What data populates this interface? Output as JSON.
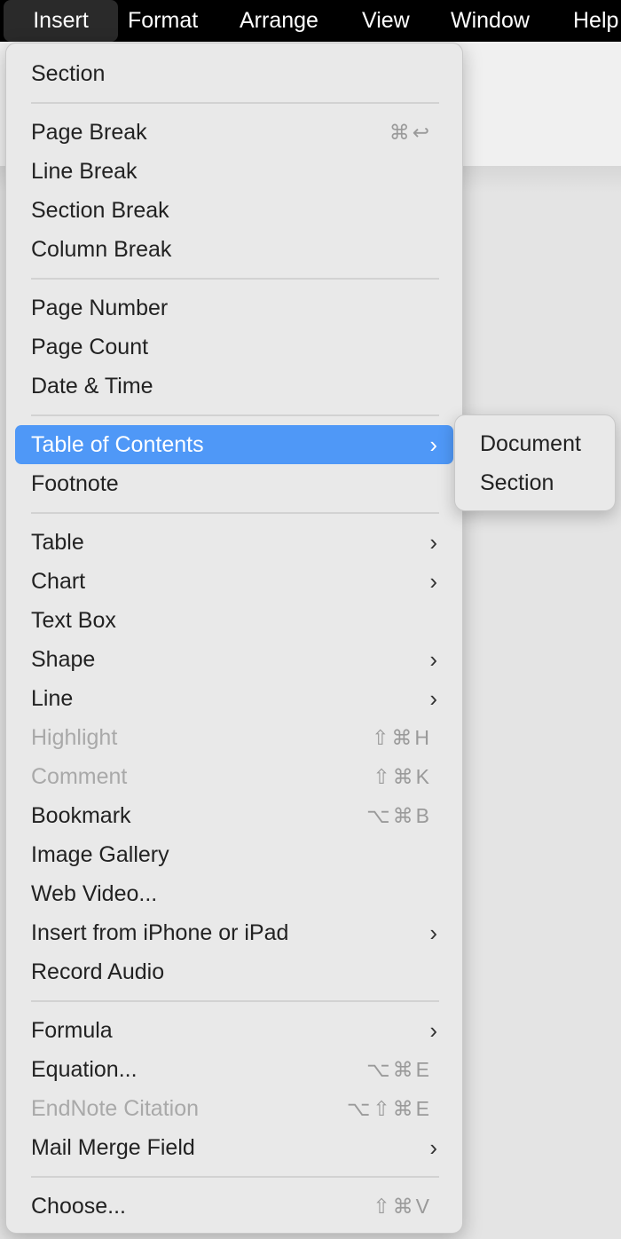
{
  "menubar": {
    "items": [
      {
        "label": "Insert",
        "active": true
      },
      {
        "label": "Format"
      },
      {
        "label": "Arrange"
      },
      {
        "label": "View"
      },
      {
        "label": "Window"
      },
      {
        "label": "Help"
      }
    ]
  },
  "insert_menu": {
    "items": [
      {
        "label": "Section"
      },
      {
        "separator": true
      },
      {
        "label": "Page Break",
        "shortcut": "⌘↩"
      },
      {
        "label": "Line Break"
      },
      {
        "label": "Section Break"
      },
      {
        "label": "Column Break"
      },
      {
        "separator": true
      },
      {
        "label": "Page Number"
      },
      {
        "label": "Page Count"
      },
      {
        "label": "Date & Time"
      },
      {
        "separator": true
      },
      {
        "label": "Table of Contents",
        "submenu": true,
        "highlighted": true
      },
      {
        "label": "Footnote"
      },
      {
        "separator": true
      },
      {
        "label": "Table",
        "submenu": true
      },
      {
        "label": "Chart",
        "submenu": true
      },
      {
        "label": "Text Box"
      },
      {
        "label": "Shape",
        "submenu": true
      },
      {
        "label": "Line",
        "submenu": true
      },
      {
        "label": "Highlight",
        "shortcut": "⇧⌘H",
        "disabled": true
      },
      {
        "label": "Comment",
        "shortcut": "⇧⌘K",
        "disabled": true
      },
      {
        "label": "Bookmark",
        "shortcut": "⌥⌘B"
      },
      {
        "label": "Image Gallery"
      },
      {
        "label": "Web Video..."
      },
      {
        "label": "Insert from iPhone or iPad",
        "submenu": true
      },
      {
        "label": "Record Audio"
      },
      {
        "separator": true
      },
      {
        "label": "Formula",
        "submenu": true
      },
      {
        "label": "Equation...",
        "shortcut": "⌥⌘E"
      },
      {
        "label": "EndNote Citation",
        "shortcut": "⌥⇧⌘E",
        "disabled": true
      },
      {
        "label": "Mail Merge Field",
        "submenu": true
      },
      {
        "separator": true
      },
      {
        "label": "Choose...",
        "shortcut": "⇧⌘V"
      }
    ]
  },
  "toc_submenu": {
    "items": [
      {
        "label": "Document"
      },
      {
        "label": "Section"
      }
    ]
  },
  "colors": {
    "highlight": "#4f98f7",
    "menubar": "#000000",
    "disabled_text": "#a9a9a9"
  },
  "icons": {
    "submenu_chevron": "›"
  }
}
